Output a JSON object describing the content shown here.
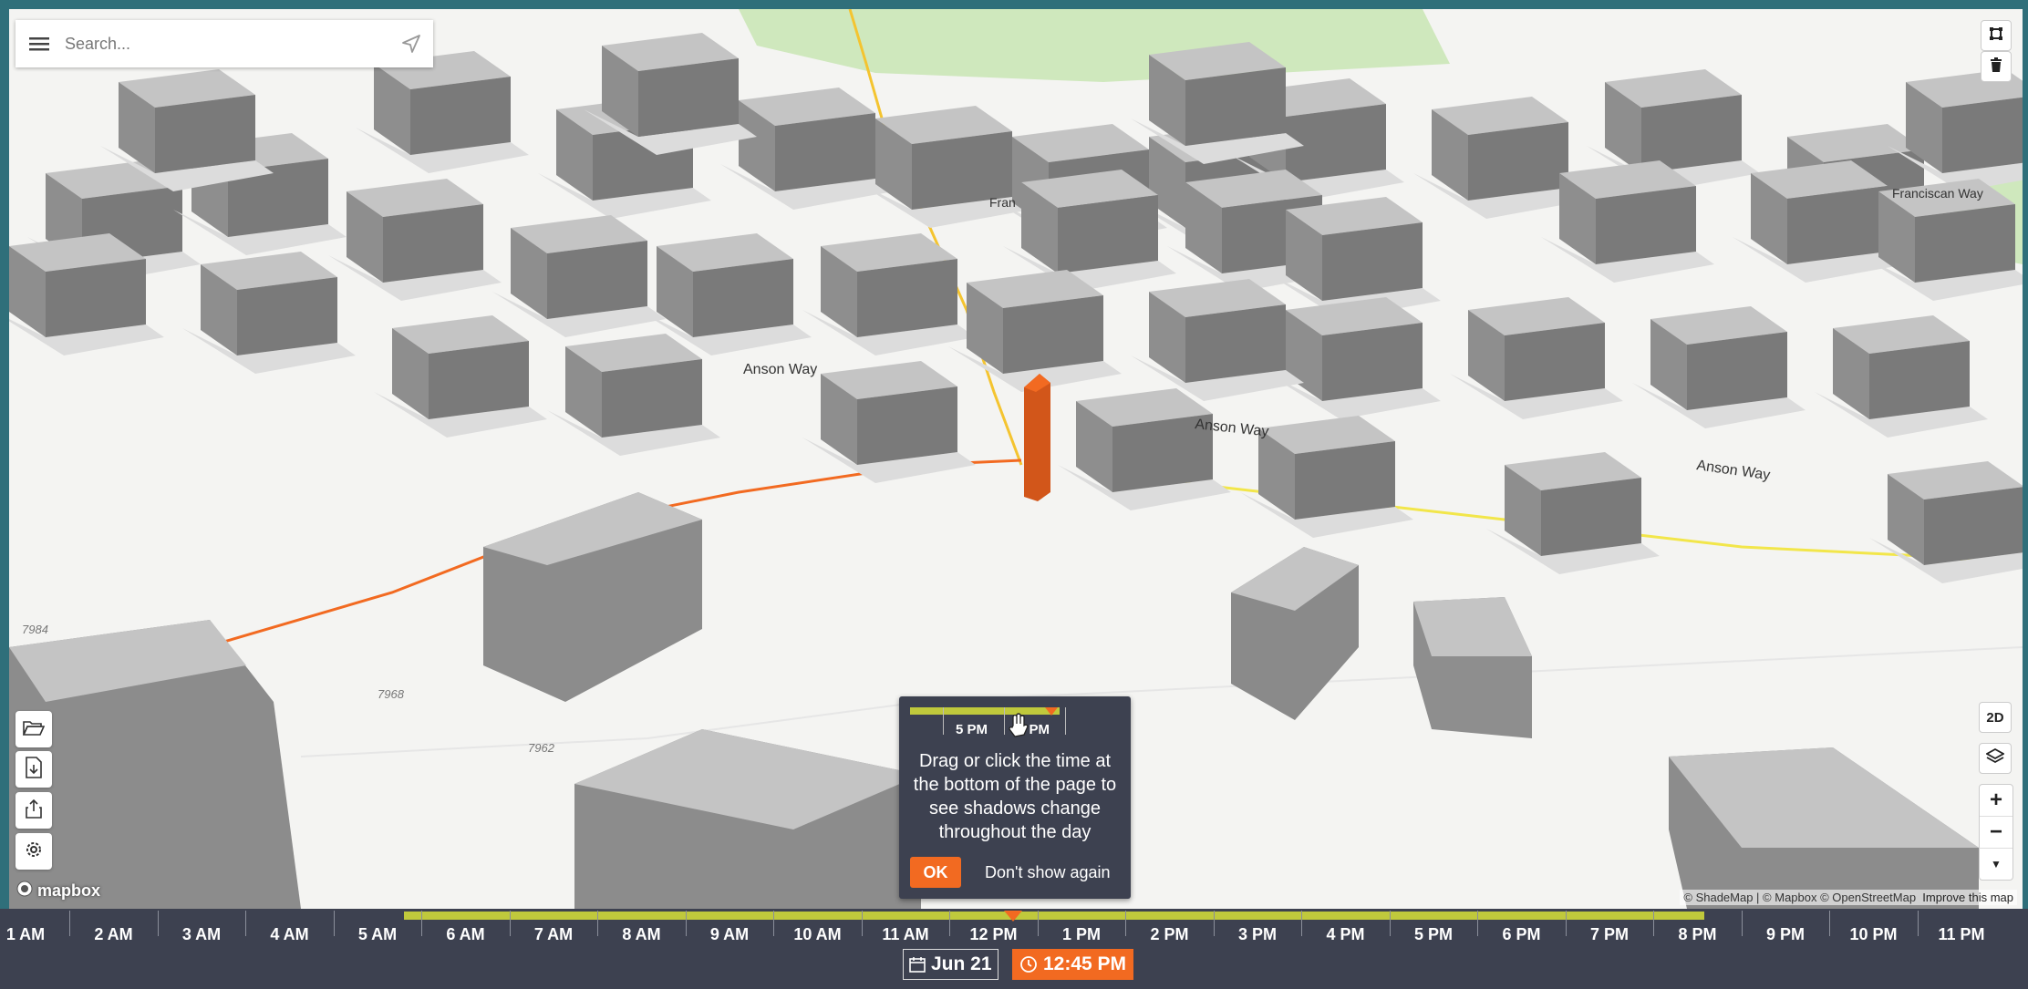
{
  "search": {
    "placeholder": "Search..."
  },
  "map": {
    "street_labels": [
      "Franciscan Way",
      "Anson Way",
      "Anson Way",
      "Anson Way",
      "Fran"
    ],
    "parcel_numbers": [
      "7984",
      "7968",
      "7962"
    ]
  },
  "controls": {
    "view_toggle": "2D"
  },
  "attribution": {
    "text": "© ShadeMap | © Mapbox © OpenStreetMap",
    "improve": "Improve this map",
    "logo": "mapbox"
  },
  "tooltip": {
    "mini_labels": [
      "5 PM",
      "6 PM"
    ],
    "message": "Drag or click the time at the bottom of the page to see shadows change throughout the day",
    "ok": "OK",
    "dont_show": "Don't show again"
  },
  "timeline": {
    "hours": [
      "1 AM",
      "2 AM",
      "3 AM",
      "4 AM",
      "5 AM",
      "6 AM",
      "7 AM",
      "8 AM",
      "9 AM",
      "10 AM",
      "11 AM",
      "12 PM",
      "1 PM",
      "2 PM",
      "3 PM",
      "4 PM",
      "5 PM",
      "6 PM",
      "7 PM",
      "8 PM",
      "9 PM",
      "10 PM",
      "11 PM"
    ],
    "date": "Jun 21",
    "time": "12:45 PM"
  },
  "colors": {
    "accent": "#f26a21",
    "daylight": "#c0c93c",
    "panel": "#3d4150"
  }
}
